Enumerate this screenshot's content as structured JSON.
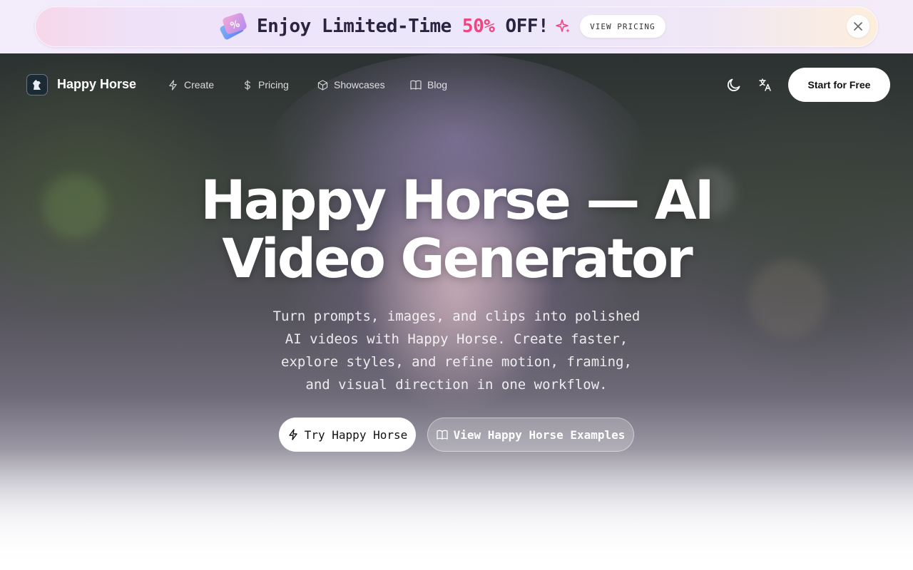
{
  "promo": {
    "text_before": "Enjoy Limited-Time ",
    "highlight": "50%",
    "text_after": " OFF!",
    "view_pricing_label": "VIEW PRICING",
    "highlight_color": "#f0457e"
  },
  "nav": {
    "brand": "Happy Horse",
    "links": [
      {
        "label": "Create",
        "icon": "lightning-icon"
      },
      {
        "label": "Pricing",
        "icon": "dollar-icon"
      },
      {
        "label": "Showcases",
        "icon": "box-icon"
      },
      {
        "label": "Blog",
        "icon": "book-icon"
      }
    ],
    "start_label": "Start for Free"
  },
  "hero": {
    "title_line1": "Happy Horse — AI",
    "title_line2": "Video Generator",
    "subtitle_lines": [
      "Turn prompts, images, and clips into polished",
      "AI videos with Happy Horse. Create faster,",
      "explore styles, and refine motion, framing,",
      "and visual direction in one workflow."
    ],
    "cta_primary": "Try Happy Horse",
    "cta_secondary": "View Happy Horse Examples"
  }
}
